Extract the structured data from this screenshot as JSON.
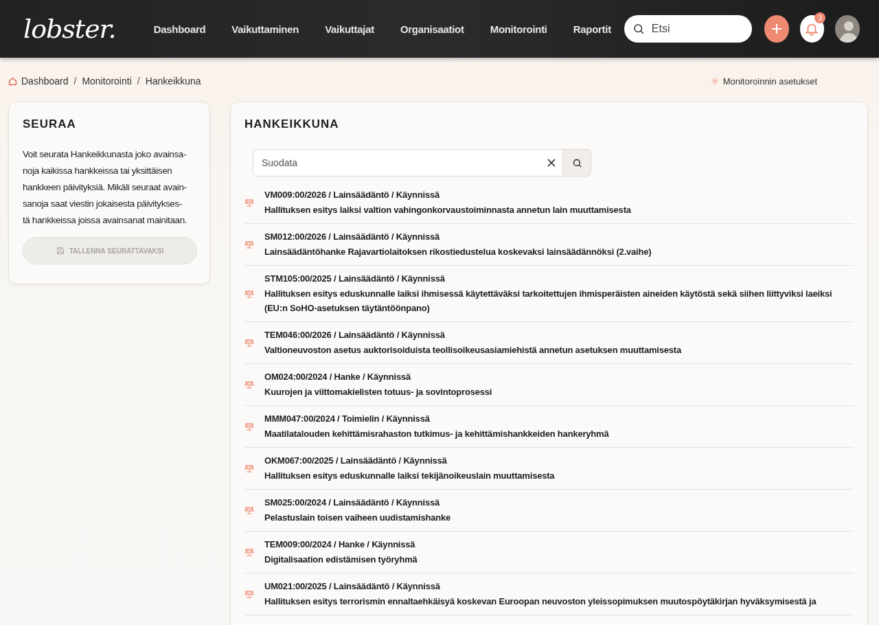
{
  "header": {
    "logo": "lobster.",
    "nav": [
      {
        "label": "Dashboard",
        "selected": false
      },
      {
        "label": "Vaikuttaminen",
        "selected": false
      },
      {
        "label": "Vaikuttajat",
        "selected": false
      },
      {
        "label": "Organisaatiot",
        "selected": false
      },
      {
        "label": "Monitorointi",
        "selected": false
      },
      {
        "label": "Raportit",
        "selected": false
      }
    ],
    "search": {
      "placeholder": "Etsi"
    },
    "notifications": "3"
  },
  "breadcrumb": [
    {
      "label": "Dashboard"
    },
    {
      "separator": "/",
      "label": "Monitorointi"
    },
    {
      "separator": "/",
      "label": "Hankeikkuna"
    }
  ],
  "settings_link": "Monitoroinnin asetukset",
  "sidebar": {
    "title": "SEURAA",
    "text": "Voit seurata Hankeikkunasta joko avainsa-\nnoja kaikissa hankkeissa tai yksittäisen\nhankkeen päivityksiä. Mikäli seuraat avain-\nsanoja saat viestin jokaisesta päivitykses-\ntä hankkeissa joissa avainsanat mainitaan.",
    "button": {
      "label": "TALLENNA SEURATTAVAKSI",
      "disabled": true
    }
  },
  "main": {
    "title": "HANKEIKKUNA",
    "filter": {
      "placeholder": "Suodata"
    },
    "items": [
      {
        "meta": "VM009:00/2026 / Lainsäädäntö / Käynnissä",
        "title": "Hallituksen esitys laiksi valtion vahingonkorvaustoiminnasta annetun lain muuttamisesta"
      },
      {
        "meta": "SM012:00/2026 / Lainsäädäntö / Käynnissä",
        "title": "Lainsäädäntöhanke Rajavartiolaitoksen rikostiedustelua koskevaksi lainsäädännöksi (2.vaihe)"
      },
      {
        "meta": "STM105:00/2025 / Lainsäädäntö / Käynnissä",
        "title": "Hallituksen esitys eduskunnalle laiksi ihmisessä käytettäväksi tarkoitettujen ihmisperäisten aineiden käytöstä sekä siihen liittyviksi laeiksi (EU:n SoHO-asetuksen täytäntöönpano)"
      },
      {
        "meta": "TEM046:00/2026 / Lainsäädäntö / Käynnissä",
        "title": "Valtioneuvoston asetus auktorisoiduista teollisoikeusasiamiehistä annetun asetuksen muuttamisesta"
      },
      {
        "meta": "OM024:00/2024 / Hanke / Käynnissä",
        "title": "Kuurojen ja viittomakielisten totuus- ja sovintoprosessi"
      },
      {
        "meta": "MMM047:00/2024 / Toimielin / Käynnissä",
        "title": "Maatilatalouden kehittämisrahaston tutkimus- ja kehittämishankkeiden hankeryhmä"
      },
      {
        "meta": "OKM067:00/2025 / Lainsäädäntö / Käynnissä",
        "title": "Hallituksen esitys eduskunnalle laiksi tekijänoikeuslain muuttamisesta"
      },
      {
        "meta": "SM025:00/2024 / Lainsäädäntö / Käynnissä",
        "title": "Pelastuslain toisen vaiheen uudistamishanke"
      },
      {
        "meta": "TEM009:00/2024 / Hanke / Käynnissä",
        "title": "Digitalisaation edistämisen työryhmä"
      },
      {
        "meta": "UM021:00/2025 / Lainsäädäntö / Käynnissä",
        "title": "Hallituksen esitys terrorismin ennaltaehkäisyä koskevan Euroopan neuvoston yleissopimuksen muutospöytäkirjan hyväksymisestä ja"
      }
    ]
  }
}
